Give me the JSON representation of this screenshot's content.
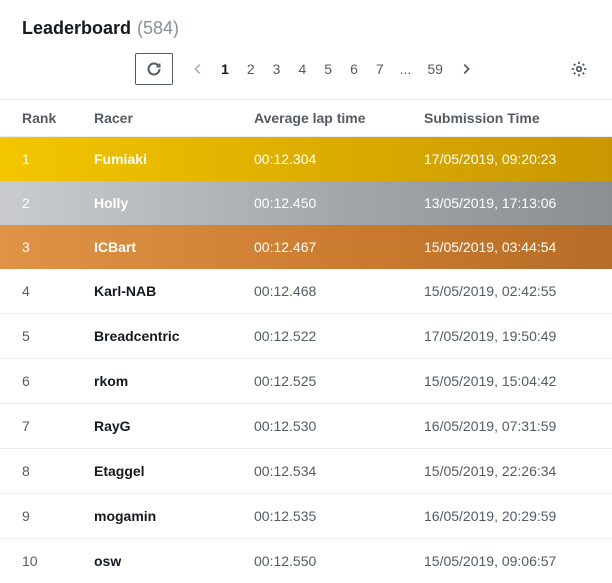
{
  "header": {
    "title": "Leaderboard",
    "count": "(584)"
  },
  "pagination": {
    "pages": [
      "1",
      "2",
      "3",
      "4",
      "5",
      "6",
      "7"
    ],
    "ellipsis": "...",
    "last": "59",
    "active": "1"
  },
  "columns": {
    "rank": "Rank",
    "racer": "Racer",
    "lap": "Average lap time",
    "submission": "Submission Time"
  },
  "rows": [
    {
      "rank": "1",
      "racer": "Fumiaki",
      "lap": "00:12.304",
      "submission": "17/05/2019, 09:20:23",
      "medal": "gold"
    },
    {
      "rank": "2",
      "racer": "Holly",
      "lap": "00:12.450",
      "submission": "13/05/2019, 17:13:06",
      "medal": "silver"
    },
    {
      "rank": "3",
      "racer": "ICBart",
      "lap": "00:12.467",
      "submission": "15/05/2019, 03:44:54",
      "medal": "bronze"
    },
    {
      "rank": "4",
      "racer": "Karl-NAB",
      "lap": "00:12.468",
      "submission": "15/05/2019, 02:42:55",
      "medal": ""
    },
    {
      "rank": "5",
      "racer": "Breadcentric",
      "lap": "00:12.522",
      "submission": "17/05/2019, 19:50:49",
      "medal": ""
    },
    {
      "rank": "6",
      "racer": "rkom",
      "lap": "00:12.525",
      "submission": "15/05/2019, 15:04:42",
      "medal": ""
    },
    {
      "rank": "7",
      "racer": "RayG",
      "lap": "00:12.530",
      "submission": "16/05/2019, 07:31:59",
      "medal": ""
    },
    {
      "rank": "8",
      "racer": "Etaggel",
      "lap": "00:12.534",
      "submission": "15/05/2019, 22:26:34",
      "medal": ""
    },
    {
      "rank": "9",
      "racer": "mogamin",
      "lap": "00:12.535",
      "submission": "16/05/2019, 20:29:59",
      "medal": ""
    },
    {
      "rank": "10",
      "racer": "osw",
      "lap": "00:12.550",
      "submission": "15/05/2019, 09:06:57",
      "medal": ""
    }
  ]
}
